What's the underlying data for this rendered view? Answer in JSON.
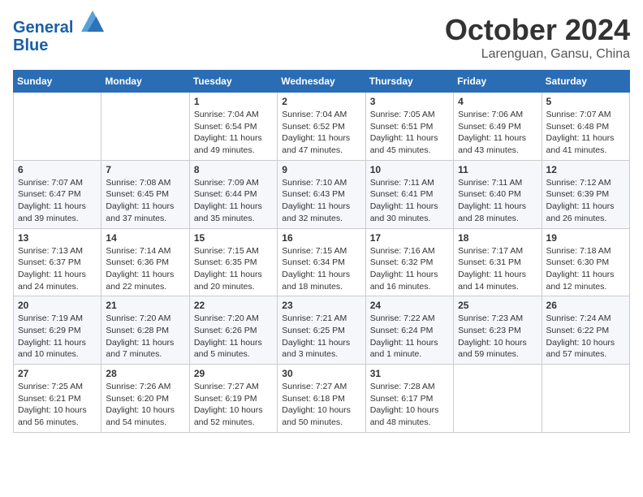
{
  "header": {
    "logo_line1": "General",
    "logo_line2": "Blue",
    "month": "October 2024",
    "location": "Larenguan, Gansu, China"
  },
  "weekdays": [
    "Sunday",
    "Monday",
    "Tuesday",
    "Wednesday",
    "Thursday",
    "Friday",
    "Saturday"
  ],
  "weeks": [
    [
      {
        "day": "",
        "info": ""
      },
      {
        "day": "",
        "info": ""
      },
      {
        "day": "1",
        "info": "Sunrise: 7:04 AM\nSunset: 6:54 PM\nDaylight: 11 hours and 49 minutes."
      },
      {
        "day": "2",
        "info": "Sunrise: 7:04 AM\nSunset: 6:52 PM\nDaylight: 11 hours and 47 minutes."
      },
      {
        "day": "3",
        "info": "Sunrise: 7:05 AM\nSunset: 6:51 PM\nDaylight: 11 hours and 45 minutes."
      },
      {
        "day": "4",
        "info": "Sunrise: 7:06 AM\nSunset: 6:49 PM\nDaylight: 11 hours and 43 minutes."
      },
      {
        "day": "5",
        "info": "Sunrise: 7:07 AM\nSunset: 6:48 PM\nDaylight: 11 hours and 41 minutes."
      }
    ],
    [
      {
        "day": "6",
        "info": "Sunrise: 7:07 AM\nSunset: 6:47 PM\nDaylight: 11 hours and 39 minutes."
      },
      {
        "day": "7",
        "info": "Sunrise: 7:08 AM\nSunset: 6:45 PM\nDaylight: 11 hours and 37 minutes."
      },
      {
        "day": "8",
        "info": "Sunrise: 7:09 AM\nSunset: 6:44 PM\nDaylight: 11 hours and 35 minutes."
      },
      {
        "day": "9",
        "info": "Sunrise: 7:10 AM\nSunset: 6:43 PM\nDaylight: 11 hours and 32 minutes."
      },
      {
        "day": "10",
        "info": "Sunrise: 7:11 AM\nSunset: 6:41 PM\nDaylight: 11 hours and 30 minutes."
      },
      {
        "day": "11",
        "info": "Sunrise: 7:11 AM\nSunset: 6:40 PM\nDaylight: 11 hours and 28 minutes."
      },
      {
        "day": "12",
        "info": "Sunrise: 7:12 AM\nSunset: 6:39 PM\nDaylight: 11 hours and 26 minutes."
      }
    ],
    [
      {
        "day": "13",
        "info": "Sunrise: 7:13 AM\nSunset: 6:37 PM\nDaylight: 11 hours and 24 minutes."
      },
      {
        "day": "14",
        "info": "Sunrise: 7:14 AM\nSunset: 6:36 PM\nDaylight: 11 hours and 22 minutes."
      },
      {
        "day": "15",
        "info": "Sunrise: 7:15 AM\nSunset: 6:35 PM\nDaylight: 11 hours and 20 minutes."
      },
      {
        "day": "16",
        "info": "Sunrise: 7:15 AM\nSunset: 6:34 PM\nDaylight: 11 hours and 18 minutes."
      },
      {
        "day": "17",
        "info": "Sunrise: 7:16 AM\nSunset: 6:32 PM\nDaylight: 11 hours and 16 minutes."
      },
      {
        "day": "18",
        "info": "Sunrise: 7:17 AM\nSunset: 6:31 PM\nDaylight: 11 hours and 14 minutes."
      },
      {
        "day": "19",
        "info": "Sunrise: 7:18 AM\nSunset: 6:30 PM\nDaylight: 11 hours and 12 minutes."
      }
    ],
    [
      {
        "day": "20",
        "info": "Sunrise: 7:19 AM\nSunset: 6:29 PM\nDaylight: 11 hours and 10 minutes."
      },
      {
        "day": "21",
        "info": "Sunrise: 7:20 AM\nSunset: 6:28 PM\nDaylight: 11 hours and 7 minutes."
      },
      {
        "day": "22",
        "info": "Sunrise: 7:20 AM\nSunset: 6:26 PM\nDaylight: 11 hours and 5 minutes."
      },
      {
        "day": "23",
        "info": "Sunrise: 7:21 AM\nSunset: 6:25 PM\nDaylight: 11 hours and 3 minutes."
      },
      {
        "day": "24",
        "info": "Sunrise: 7:22 AM\nSunset: 6:24 PM\nDaylight: 11 hours and 1 minute."
      },
      {
        "day": "25",
        "info": "Sunrise: 7:23 AM\nSunset: 6:23 PM\nDaylight: 10 hours and 59 minutes."
      },
      {
        "day": "26",
        "info": "Sunrise: 7:24 AM\nSunset: 6:22 PM\nDaylight: 10 hours and 57 minutes."
      }
    ],
    [
      {
        "day": "27",
        "info": "Sunrise: 7:25 AM\nSunset: 6:21 PM\nDaylight: 10 hours and 56 minutes."
      },
      {
        "day": "28",
        "info": "Sunrise: 7:26 AM\nSunset: 6:20 PM\nDaylight: 10 hours and 54 minutes."
      },
      {
        "day": "29",
        "info": "Sunrise: 7:27 AM\nSunset: 6:19 PM\nDaylight: 10 hours and 52 minutes."
      },
      {
        "day": "30",
        "info": "Sunrise: 7:27 AM\nSunset: 6:18 PM\nDaylight: 10 hours and 50 minutes."
      },
      {
        "day": "31",
        "info": "Sunrise: 7:28 AM\nSunset: 6:17 PM\nDaylight: 10 hours and 48 minutes."
      },
      {
        "day": "",
        "info": ""
      },
      {
        "day": "",
        "info": ""
      }
    ]
  ]
}
